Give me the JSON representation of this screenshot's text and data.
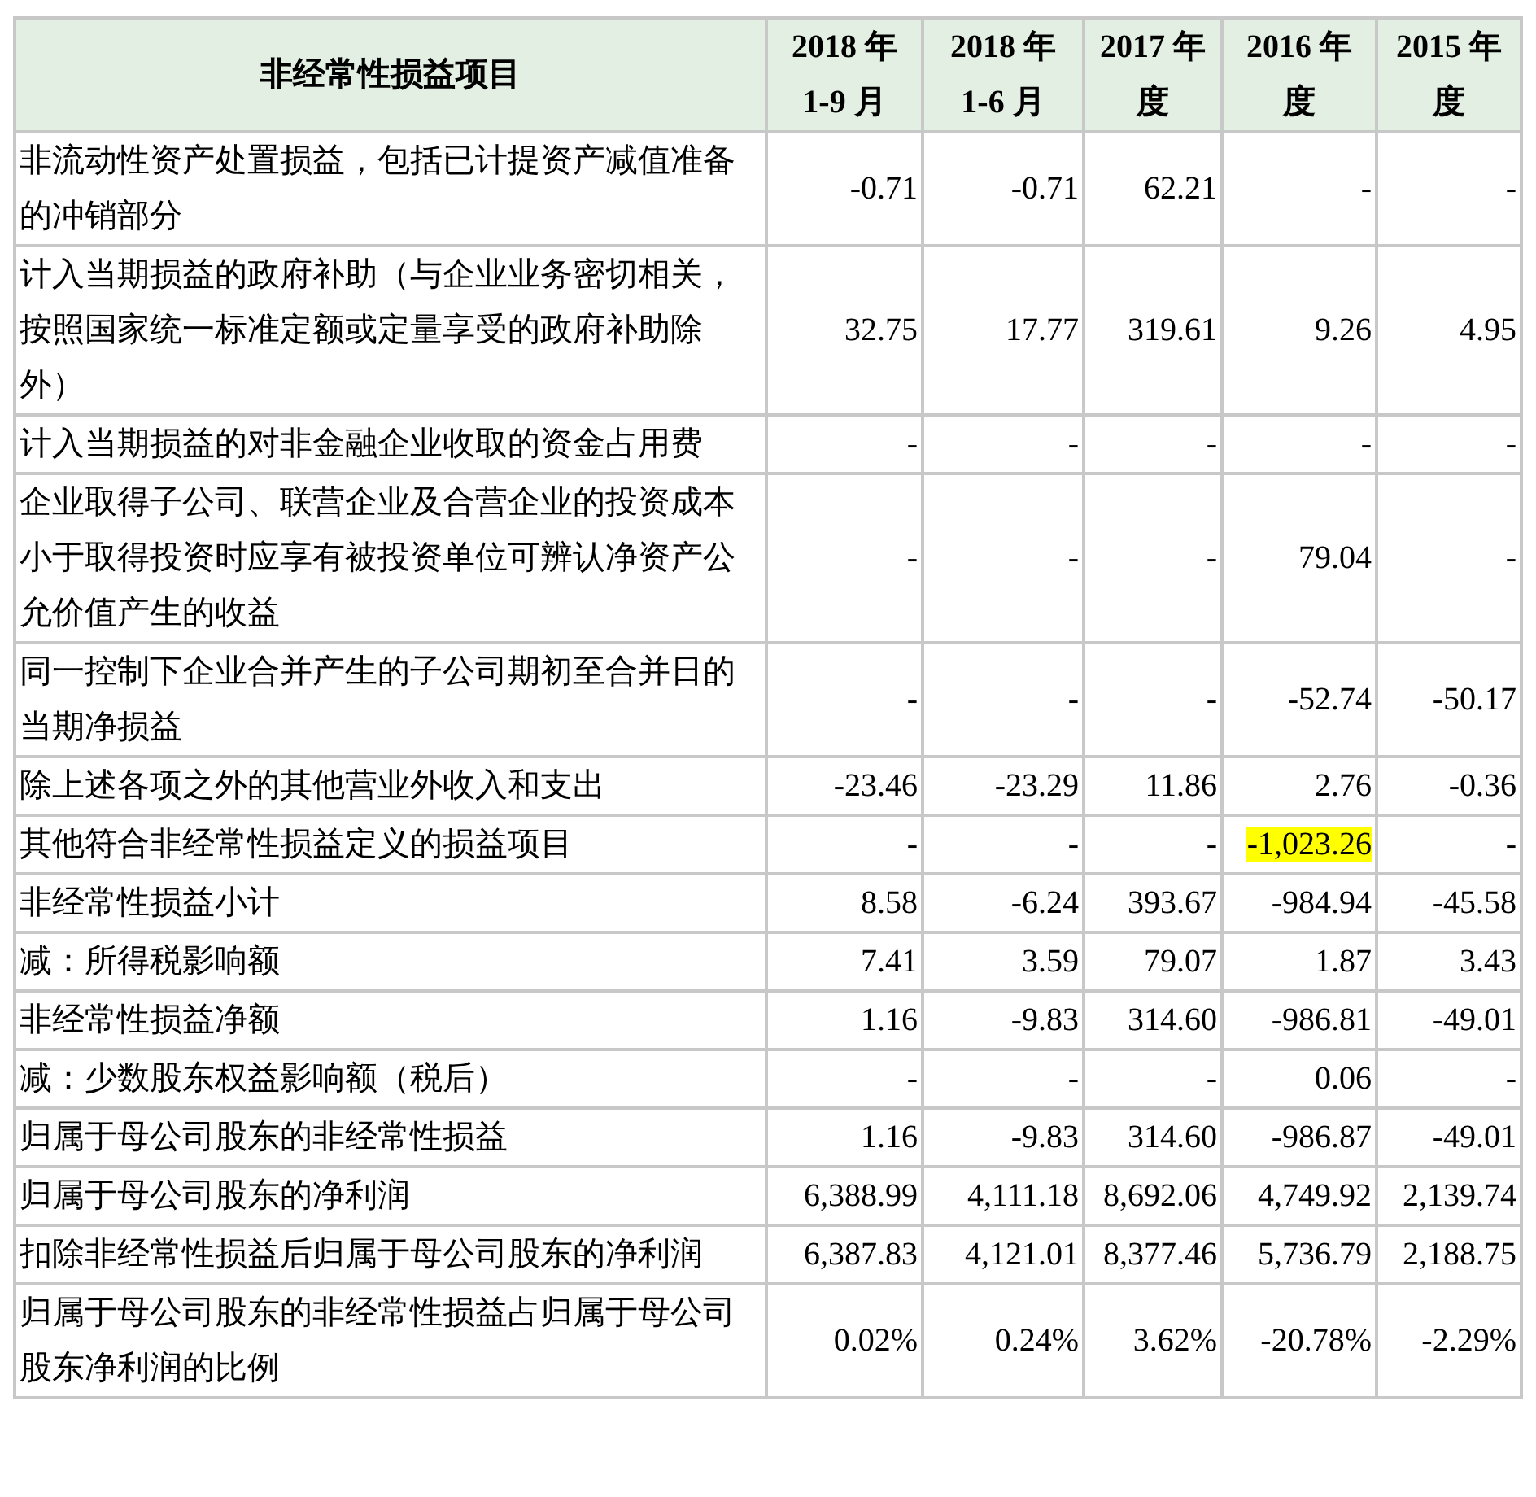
{
  "table": {
    "columns": [
      {
        "lines": [
          "非经常性损益项目"
        ]
      },
      {
        "lines": [
          "2018 年",
          "1-9 月"
        ]
      },
      {
        "lines": [
          "2018 年",
          "1-6 月"
        ]
      },
      {
        "lines": [
          "2017 年",
          "度"
        ]
      },
      {
        "lines": [
          "2016 年",
          "度"
        ]
      },
      {
        "lines": [
          "2015 年",
          "度"
        ]
      }
    ],
    "rows": [
      {
        "item": "非流动性资产处置损益，包括已计提资产减值准备的冲销部分",
        "values": [
          {
            "text": "-0.71",
            "highlighted": false
          },
          {
            "text": "-0.71",
            "highlighted": false
          },
          {
            "text": "62.21",
            "highlighted": false
          },
          {
            "text": "-",
            "highlighted": false
          },
          {
            "text": "-",
            "highlighted": false
          }
        ]
      },
      {
        "item": "计入当期损益的政府补助（与企业业务密切相关，按照国家统一标准定额或定量享受的政府补助除外）",
        "values": [
          {
            "text": "32.75",
            "highlighted": false
          },
          {
            "text": "17.77",
            "highlighted": false
          },
          {
            "text": "319.61",
            "highlighted": false
          },
          {
            "text": "9.26",
            "highlighted": false
          },
          {
            "text": "4.95",
            "highlighted": false
          }
        ]
      },
      {
        "item": "计入当期损益的对非金融企业收取的资金占用费",
        "values": [
          {
            "text": "-",
            "highlighted": false
          },
          {
            "text": "-",
            "highlighted": false
          },
          {
            "text": "-",
            "highlighted": false
          },
          {
            "text": "-",
            "highlighted": false
          },
          {
            "text": "-",
            "highlighted": false
          }
        ]
      },
      {
        "item": "企业取得子公司、联营企业及合营企业的投资成本小于取得投资时应享有被投资单位可辨认净资产公允价值产生的收益",
        "values": [
          {
            "text": "-",
            "highlighted": false
          },
          {
            "text": "-",
            "highlighted": false
          },
          {
            "text": "-",
            "highlighted": false
          },
          {
            "text": "79.04",
            "highlighted": false
          },
          {
            "text": "-",
            "highlighted": false
          }
        ]
      },
      {
        "item": "同一控制下企业合并产生的子公司期初至合并日的当期净损益",
        "values": [
          {
            "text": "-",
            "highlighted": false
          },
          {
            "text": "-",
            "highlighted": false
          },
          {
            "text": "-",
            "highlighted": false
          },
          {
            "text": "-52.74",
            "highlighted": false
          },
          {
            "text": "-50.17",
            "highlighted": false
          }
        ]
      },
      {
        "item": "除上述各项之外的其他营业外收入和支出",
        "values": [
          {
            "text": "-23.46",
            "highlighted": false
          },
          {
            "text": "-23.29",
            "highlighted": false
          },
          {
            "text": "11.86",
            "highlighted": false
          },
          {
            "text": "2.76",
            "highlighted": false
          },
          {
            "text": "-0.36",
            "highlighted": false
          }
        ]
      },
      {
        "item": "其他符合非经常性损益定义的损益项目",
        "values": [
          {
            "text": "-",
            "highlighted": false
          },
          {
            "text": "-",
            "highlighted": false
          },
          {
            "text": "-",
            "highlighted": false
          },
          {
            "text": "-1,023.26",
            "highlighted": true
          },
          {
            "text": "-",
            "highlighted": false
          }
        ]
      },
      {
        "item": "非经常性损益小计",
        "values": [
          {
            "text": "8.58",
            "highlighted": false
          },
          {
            "text": "-6.24",
            "highlighted": false
          },
          {
            "text": "393.67",
            "highlighted": false
          },
          {
            "text": "-984.94",
            "highlighted": false
          },
          {
            "text": "-45.58",
            "highlighted": false
          }
        ]
      },
      {
        "item": "减：所得税影响额",
        "values": [
          {
            "text": "7.41",
            "highlighted": false
          },
          {
            "text": "3.59",
            "highlighted": false
          },
          {
            "text": "79.07",
            "highlighted": false
          },
          {
            "text": "1.87",
            "highlighted": false
          },
          {
            "text": "3.43",
            "highlighted": false
          }
        ]
      },
      {
        "item": "非经常性损益净额",
        "values": [
          {
            "text": "1.16",
            "highlighted": false
          },
          {
            "text": "-9.83",
            "highlighted": false
          },
          {
            "text": "314.60",
            "highlighted": false
          },
          {
            "text": "-986.81",
            "highlighted": false
          },
          {
            "text": "-49.01",
            "highlighted": false
          }
        ]
      },
      {
        "item": "减：少数股东权益影响额（税后）",
        "values": [
          {
            "text": "-",
            "highlighted": false
          },
          {
            "text": "-",
            "highlighted": false
          },
          {
            "text": "-",
            "highlighted": false
          },
          {
            "text": "0.06",
            "highlighted": false
          },
          {
            "text": "-",
            "highlighted": false
          }
        ]
      },
      {
        "item": "归属于母公司股东的非经常性损益",
        "values": [
          {
            "text": "1.16",
            "highlighted": false
          },
          {
            "text": "-9.83",
            "highlighted": false
          },
          {
            "text": "314.60",
            "highlighted": false
          },
          {
            "text": "-986.87",
            "highlighted": false
          },
          {
            "text": "-49.01",
            "highlighted": false
          }
        ]
      },
      {
        "item": "归属于母公司股东的净利润",
        "values": [
          {
            "text": "6,388.99",
            "highlighted": false
          },
          {
            "text": "4,111.18",
            "highlighted": false
          },
          {
            "text": "8,692.06",
            "highlighted": false
          },
          {
            "text": "4,749.92",
            "highlighted": false
          },
          {
            "text": "2,139.74",
            "highlighted": false
          }
        ]
      },
      {
        "item": "扣除非经常性损益后归属于母公司股东的净利润",
        "values": [
          {
            "text": "6,387.83",
            "highlighted": false
          },
          {
            "text": "4,121.01",
            "highlighted": false
          },
          {
            "text": "8,377.46",
            "highlighted": false
          },
          {
            "text": "5,736.79",
            "highlighted": false
          },
          {
            "text": "2,188.75",
            "highlighted": false
          }
        ]
      },
      {
        "item": "归属于母公司股东的非经常性损益占归属于母公司股东净利润的比例",
        "values": [
          {
            "text": "0.02%",
            "highlighted": false
          },
          {
            "text": "0.24%",
            "highlighted": false
          },
          {
            "text": "3.62%",
            "highlighted": false
          },
          {
            "text": "-20.78%",
            "highlighted": false
          },
          {
            "text": "-2.29%",
            "highlighted": false
          }
        ]
      }
    ]
  }
}
